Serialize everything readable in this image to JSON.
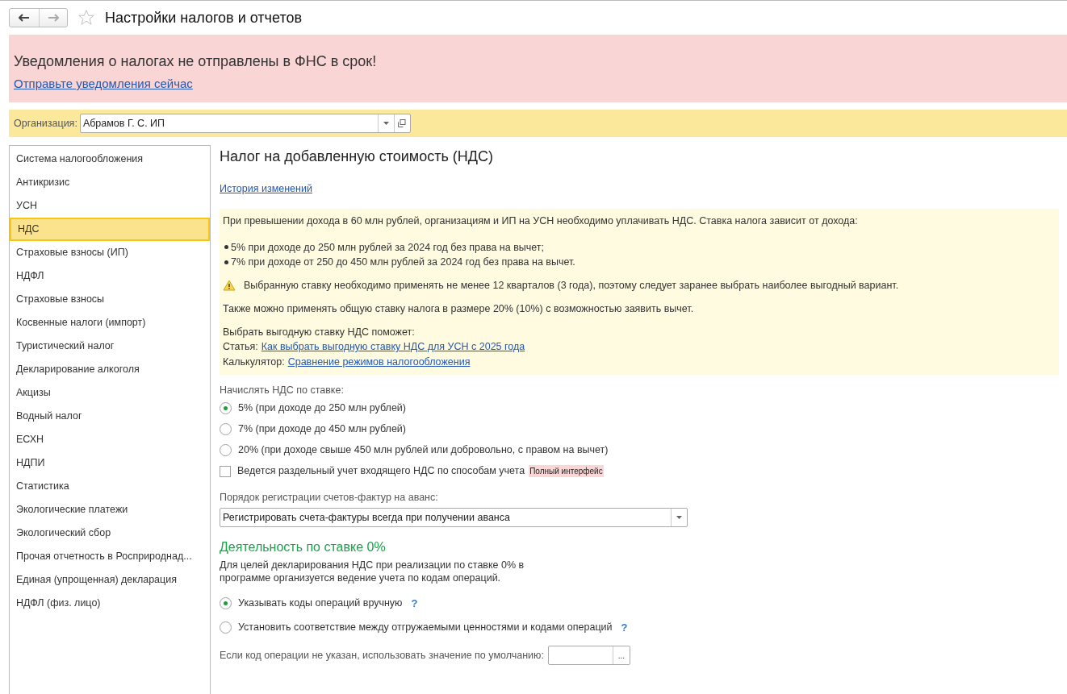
{
  "header": {
    "title": "Настройки налогов и отчетов",
    "favorite": false
  },
  "alert": {
    "message": "Уведомления о налогах не отправлены в ФНС в срок!",
    "link": "Отправьте уведомления сейчас"
  },
  "organization": {
    "label": "Организация:",
    "value": "Абрамов Г. С. ИП"
  },
  "sidebar": {
    "items": [
      {
        "label": "Система налогообложения",
        "selected": false
      },
      {
        "label": "Антикризис",
        "selected": false
      },
      {
        "label": "УСН",
        "selected": false
      },
      {
        "label": "НДС",
        "selected": true
      },
      {
        "label": "Страховые взносы (ИП)",
        "selected": false
      },
      {
        "label": "НДФЛ",
        "selected": false
      },
      {
        "label": "Страховые взносы",
        "selected": false
      },
      {
        "label": "Косвенные налоги (импорт)",
        "selected": false
      },
      {
        "label": "Туристический налог",
        "selected": false
      },
      {
        "label": "Декларирование алкоголя",
        "selected": false
      },
      {
        "label": "Акцизы",
        "selected": false
      },
      {
        "label": "Водный налог",
        "selected": false
      },
      {
        "label": "ЕСХН",
        "selected": false
      },
      {
        "label": "НДПИ",
        "selected": false
      },
      {
        "label": "Статистика",
        "selected": false
      },
      {
        "label": "Экологические платежи",
        "selected": false
      },
      {
        "label": "Экологический сбор",
        "selected": false
      },
      {
        "label": "Прочая отчетность в Росприроднад...",
        "selected": false
      },
      {
        "label": "Единая (упрощенная) декларация",
        "selected": false
      },
      {
        "label": "НДФЛ (физ. лицо)",
        "selected": false
      }
    ]
  },
  "content": {
    "title": "Налог на добавленную стоимость (НДС)",
    "history_link": "История изменений",
    "info": {
      "intro": "При превышении дохода в 60 млн рублей, организациям и ИП на УСН необходимо уплачивать НДС. Ставка налога зависит от дохода:",
      "bullets": [
        "5% при доходе до 250 млн рублей за 2024 год без права на вычет;",
        "7% при доходе от 250 до 450 млн рублей за 2024 год без права на вычет."
      ],
      "warning": "Выбранную ставку необходимо применять не менее 12 кварталов (3 года), поэтому следует заранее выбрать наиболее выгодный вариант.",
      "general": "Также можно применять общую ставку налога в размере 20% (10%) с возможностью заявить вычет.",
      "help_heading": "Выбрать выгодную ставку НДС поможет:",
      "links": [
        {
          "prefix": "Статья:",
          "link": "Как выбрать выгодную ставку НДС для УСН с 2025 года"
        },
        {
          "prefix": "Калькулятор:",
          "link": "Сравнение режимов налогообложения"
        }
      ]
    },
    "rate_label": "Начислять НДС по ставке:",
    "rates": [
      {
        "label": "5% (при доходе до 250 млн рублей)",
        "selected": true
      },
      {
        "label": "7% (при доходе до 450 млн рублей)",
        "selected": false
      },
      {
        "label": "20% (при доходе свыше 450 млн рублей или добровольно, с правом на вычет)",
        "selected": false
      }
    ],
    "separate_accounting": {
      "label": "Ведется раздельный учет входящего НДС по способам учета",
      "checked": false,
      "badge": "Полный интерфейс"
    },
    "invoice_label": "Порядок регистрации счетов-фактур на аванс:",
    "invoice_value": "Регистрировать счета-фактуры всегда при получении аванса",
    "zero_title": "Деятельность по ставке 0%",
    "zero_description": "Для целей декларирования НДС при реализации по ставке 0% в программе организуется ведение учета по кодам операций.",
    "zero_options": [
      {
        "label": "Указывать коды операций вручную",
        "selected": true,
        "help": "?"
      },
      {
        "label": "Установить соответствие между отгружаемыми ценностями и кодами операций",
        "selected": false,
        "help": "?"
      }
    ],
    "default_code_label": "Если код операции не указан, использовать значение по умолчанию:",
    "default_code_button": "..."
  }
}
